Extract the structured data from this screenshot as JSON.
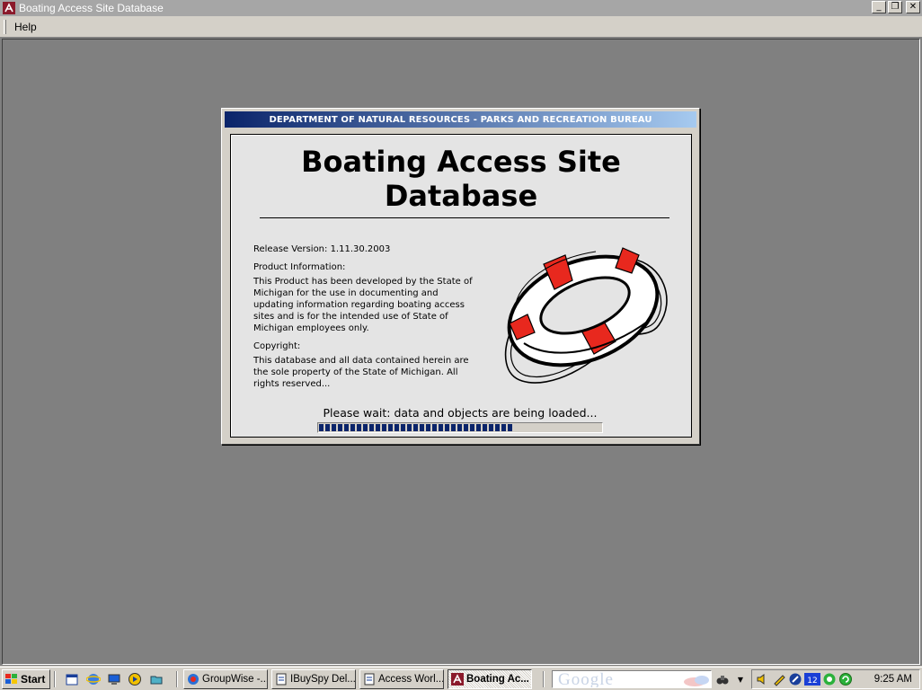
{
  "window": {
    "title": "Boating Access Site Database",
    "minimize_glyph": "_",
    "restore_glyph": "❐",
    "close_glyph": "✕"
  },
  "menu": {
    "help_label": "Help"
  },
  "splash": {
    "caption": "DEPARTMENT OF NATURAL RESOURCES - PARKS AND RECREATION BUREAU",
    "title_line1": "Boating Access Site",
    "title_line2": "Database",
    "release": "Release Version: 1.11.30.2003",
    "product_info_label": "Product Information:",
    "product_info_text": "This Product has been developed by the State of Michigan for the use in documenting and updating information regarding boating access sites and is for the intended use of State of Michigan employees only.",
    "copyright_label": "Copyright:",
    "copyright_text": "This database and all data contained herein are the sole property of the State of Michigan. All rights reserved...",
    "status": "Please wait: data and objects are being loaded...",
    "progress_percent": 69,
    "lifebuoy_color": "#e8281e",
    "accent": "#0a246a"
  },
  "taskbar": {
    "start_label": "Start",
    "tasks": [
      {
        "label": "GroupWise -..."
      },
      {
        "label": "IBuySpy Del..."
      },
      {
        "label": "Access Worl..."
      },
      {
        "label": "Boating Ac..."
      }
    ],
    "google_text": "Google",
    "tray_badge": "12",
    "clock": "9:25 AM"
  }
}
